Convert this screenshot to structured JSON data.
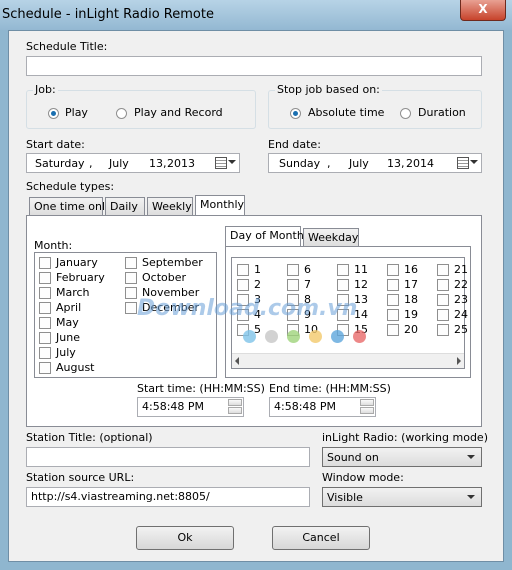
{
  "window": {
    "title": "Schedule - inLight Radio Remote",
    "close_glyph": "X"
  },
  "schedule_title": {
    "label": "Schedule Title:",
    "value": ""
  },
  "job": {
    "label": "Job:",
    "play": "Play",
    "play_record": "Play and Record"
  },
  "stop": {
    "label": "Stop job based on:",
    "absolute": "Absolute time",
    "duration": "Duration"
  },
  "start_date": {
    "label": "Start date:",
    "weekday": "Saturday",
    "month": "July",
    "day": "13,",
    "year": "2013"
  },
  "end_date": {
    "label": "End date:",
    "weekday": "Sunday",
    "month": "July",
    "day": "13,",
    "year": "2014"
  },
  "schedule_types": {
    "label": "Schedule types:",
    "tabs": [
      "One time only",
      "Daily",
      "Weekly",
      "Monthly"
    ]
  },
  "month": {
    "label": "Month:",
    "col1": [
      "January",
      "February",
      "March",
      "April",
      "May",
      "June",
      "July",
      "August"
    ],
    "col2": [
      "September",
      "October",
      "November",
      "December"
    ]
  },
  "day_tabs": [
    "Day of Month",
    "Weekday"
  ],
  "days": {
    "col1": [
      "1",
      "2",
      "3",
      "4",
      "5"
    ],
    "col2": [
      "6",
      "7",
      "8",
      "9",
      "10"
    ],
    "col3": [
      "11",
      "12",
      "13",
      "14",
      "15"
    ],
    "col4": [
      "16",
      "17",
      "18",
      "19",
      "20"
    ],
    "col5": [
      "21",
      "22",
      "23",
      "24",
      "25"
    ]
  },
  "start_time": {
    "label": "Start time: (HH:MM:SS)",
    "value": "4:58:48 PM"
  },
  "end_time": {
    "label": "End time: (HH:MM:SS)",
    "value": "4:58:48 PM"
  },
  "station_title": {
    "label": "Station Title: (optional)",
    "value": ""
  },
  "station_url": {
    "label": "Station source URL:",
    "value": "http://s4.viastreaming.net:8805/"
  },
  "radio_mode": {
    "label": "inLight Radio: (working mode)",
    "value": "Sound on"
  },
  "window_mode": {
    "label": "Window mode:",
    "value": "Visible"
  },
  "buttons": {
    "ok": "Ok",
    "cancel": "Cancel"
  },
  "watermark": {
    "text": "Download.com.vn",
    "dot_colors": [
      "#7ec3e8",
      "#c7c7c7",
      "#9fd37a",
      "#f2c96b",
      "#5ea6dc",
      "#e86a6a"
    ]
  }
}
